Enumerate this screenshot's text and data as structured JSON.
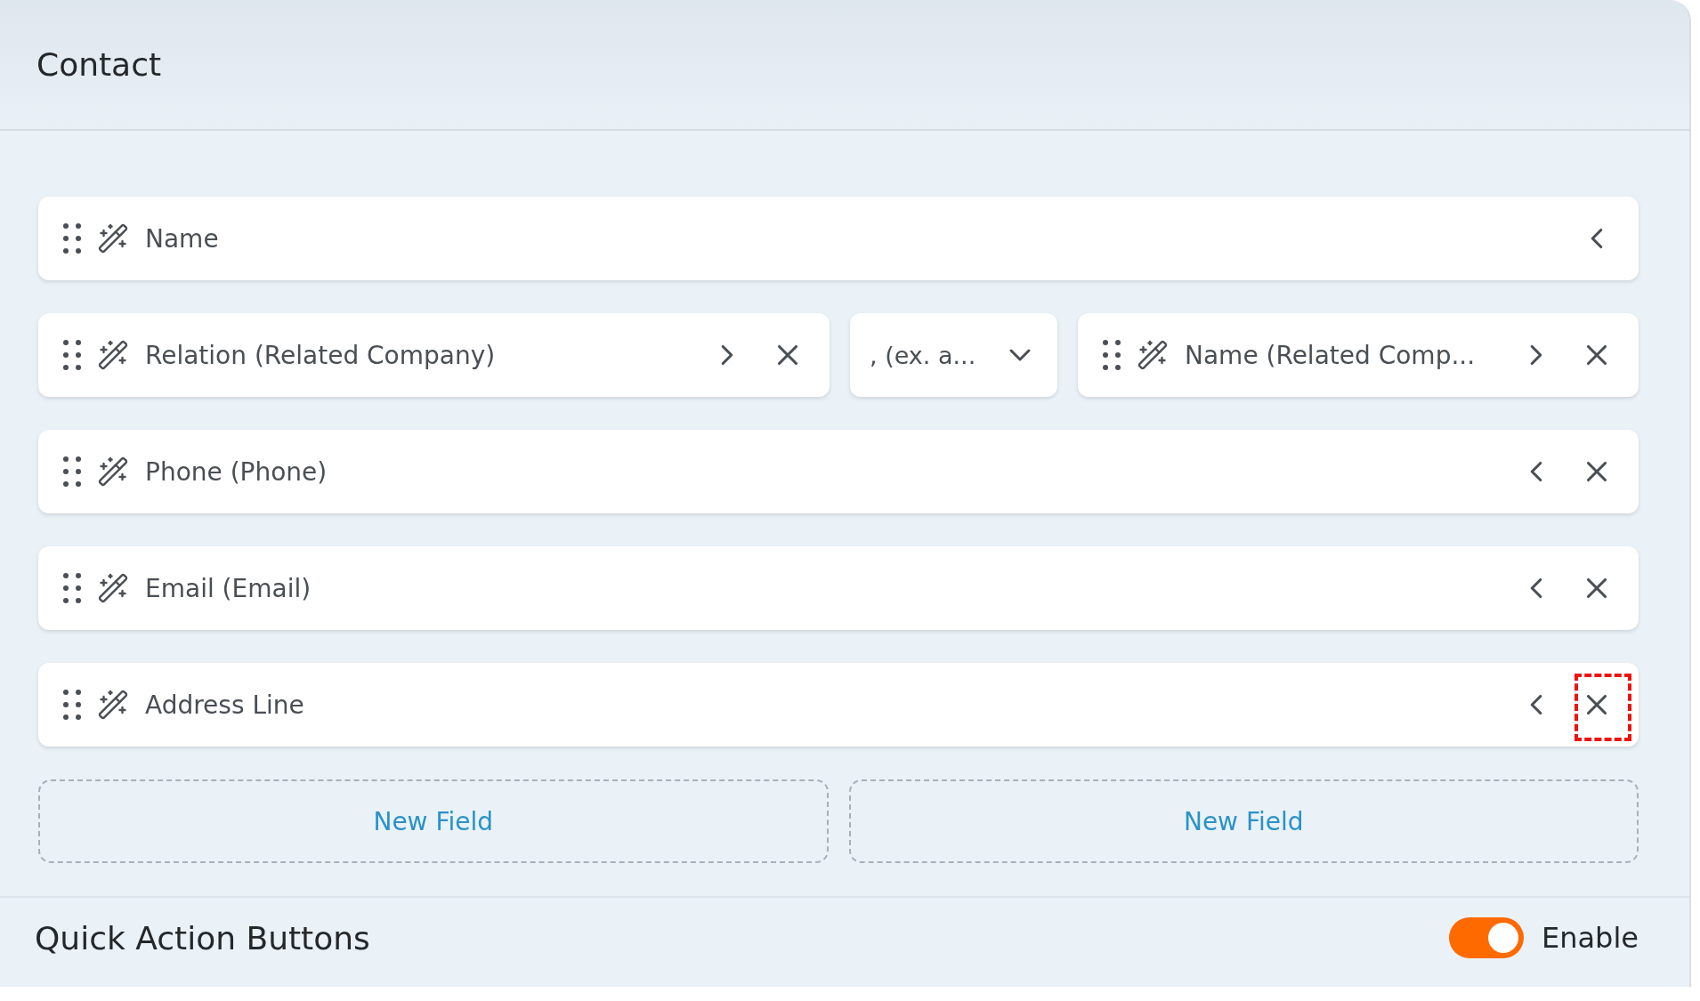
{
  "panel": {
    "title": "Contact"
  },
  "rows": [
    {
      "items": [
        {
          "kind": "field",
          "label": "Name",
          "expanded": false,
          "removable": false,
          "remove_highlighted": false
        }
      ]
    },
    {
      "items": [
        {
          "kind": "field",
          "label": "Relation (Related Company)",
          "expanded": true,
          "removable": true,
          "remove_highlighted": false
        },
        {
          "kind": "separator",
          "value": ", (ex. a..."
        },
        {
          "kind": "field",
          "label": "Name (Related Comp...",
          "expanded": true,
          "removable": true,
          "remove_highlighted": false
        }
      ]
    },
    {
      "items": [
        {
          "kind": "field",
          "label": "Phone (Phone)",
          "expanded": false,
          "removable": true,
          "remove_highlighted": false
        }
      ]
    },
    {
      "items": [
        {
          "kind": "field",
          "label": "Email (Email)",
          "expanded": false,
          "removable": true,
          "remove_highlighted": false
        }
      ]
    },
    {
      "items": [
        {
          "kind": "field",
          "label": "Address Line",
          "expanded": false,
          "removable": true,
          "remove_highlighted": true
        }
      ]
    }
  ],
  "new_field_buttons": [
    "New Field",
    "New Field"
  ],
  "quick_actions": {
    "title": "Quick Action Buttons",
    "enabled": true,
    "label": "Enable"
  }
}
